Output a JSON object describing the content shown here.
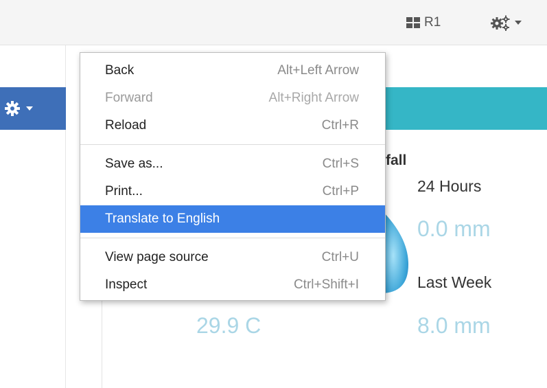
{
  "topbar": {
    "role_label": "R1",
    "role_icon": "grid-icon",
    "settings_icon": "gears-icon"
  },
  "colors": {
    "topbar_bg": "#f5f5f5",
    "toolbar_blue": "#3e6fb8",
    "widget_teal": "#35b6c6",
    "value_light_blue": "#aad6e6",
    "menu_highlight": "#3c80e6"
  },
  "widget": {
    "rainfall_title": "fall",
    "period_24h_label": "24 Hours",
    "period_24h_value": "0.0 mm",
    "period_week_label": "Last Week",
    "period_week_value": "8.0 mm",
    "temperature_value": "29.9 C"
  },
  "context_menu": {
    "groups": [
      [
        {
          "label": "Back",
          "shortcut": "Alt+Left Arrow",
          "state": "normal"
        },
        {
          "label": "Forward",
          "shortcut": "Alt+Right Arrow",
          "state": "disabled"
        },
        {
          "label": "Reload",
          "shortcut": "Ctrl+R",
          "state": "normal"
        }
      ],
      [
        {
          "label": "Save as...",
          "shortcut": "Ctrl+S",
          "state": "normal"
        },
        {
          "label": "Print...",
          "shortcut": "Ctrl+P",
          "state": "normal"
        },
        {
          "label": "Translate to English",
          "shortcut": "",
          "state": "highlighted"
        }
      ],
      [
        {
          "label": "View page source",
          "shortcut": "Ctrl+U",
          "state": "normal"
        },
        {
          "label": "Inspect",
          "shortcut": "Ctrl+Shift+I",
          "state": "normal"
        }
      ]
    ]
  }
}
